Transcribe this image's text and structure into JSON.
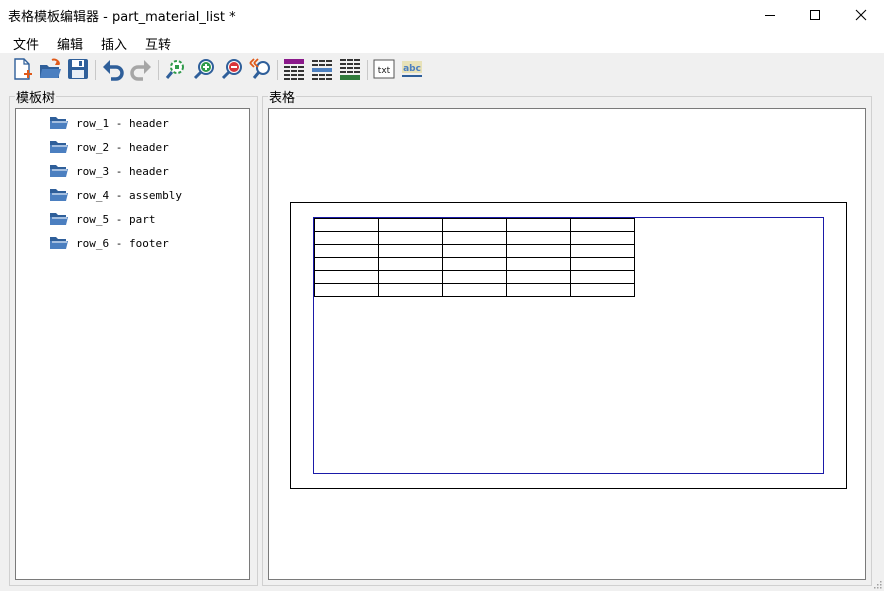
{
  "window": {
    "title": "表格模板编辑器 - part_material_list *",
    "minimize_glyph": "—",
    "maximize_glyph": "☐",
    "close_glyph": "✕"
  },
  "menu": {
    "items": [
      {
        "label": "文件"
      },
      {
        "label": "编辑"
      },
      {
        "label": "插入"
      },
      {
        "label": "互转"
      }
    ]
  },
  "toolbar": {
    "groups": [
      [
        "new-file-icon",
        "open-folder-icon",
        "save-icon"
      ],
      [
        "undo-icon",
        "redo-icon"
      ],
      [
        "zoom-fit-icon",
        "zoom-in-icon",
        "zoom-out-icon",
        "zoom-reset-icon"
      ],
      [
        "table-style-purple-icon",
        "table-style-blue-icon",
        "table-style-green-icon"
      ],
      [
        "text-txt-icon",
        "text-abc-icon"
      ]
    ]
  },
  "tree_panel": {
    "title": "模板树",
    "items": [
      {
        "label": "row_1 - header"
      },
      {
        "label": "row_2 - header"
      },
      {
        "label": "row_3 - header"
      },
      {
        "label": "row_4 - assembly"
      },
      {
        "label": "row_5 - part"
      },
      {
        "label": "row_6 - footer"
      }
    ]
  },
  "canvas_panel": {
    "title": "表格",
    "table": {
      "rows": 6,
      "cols": 5
    }
  },
  "colors": {
    "folder_icon": "#3a6aa0",
    "print_area_border": "#1a1aa8",
    "window_bg": "#f0f0f0"
  }
}
